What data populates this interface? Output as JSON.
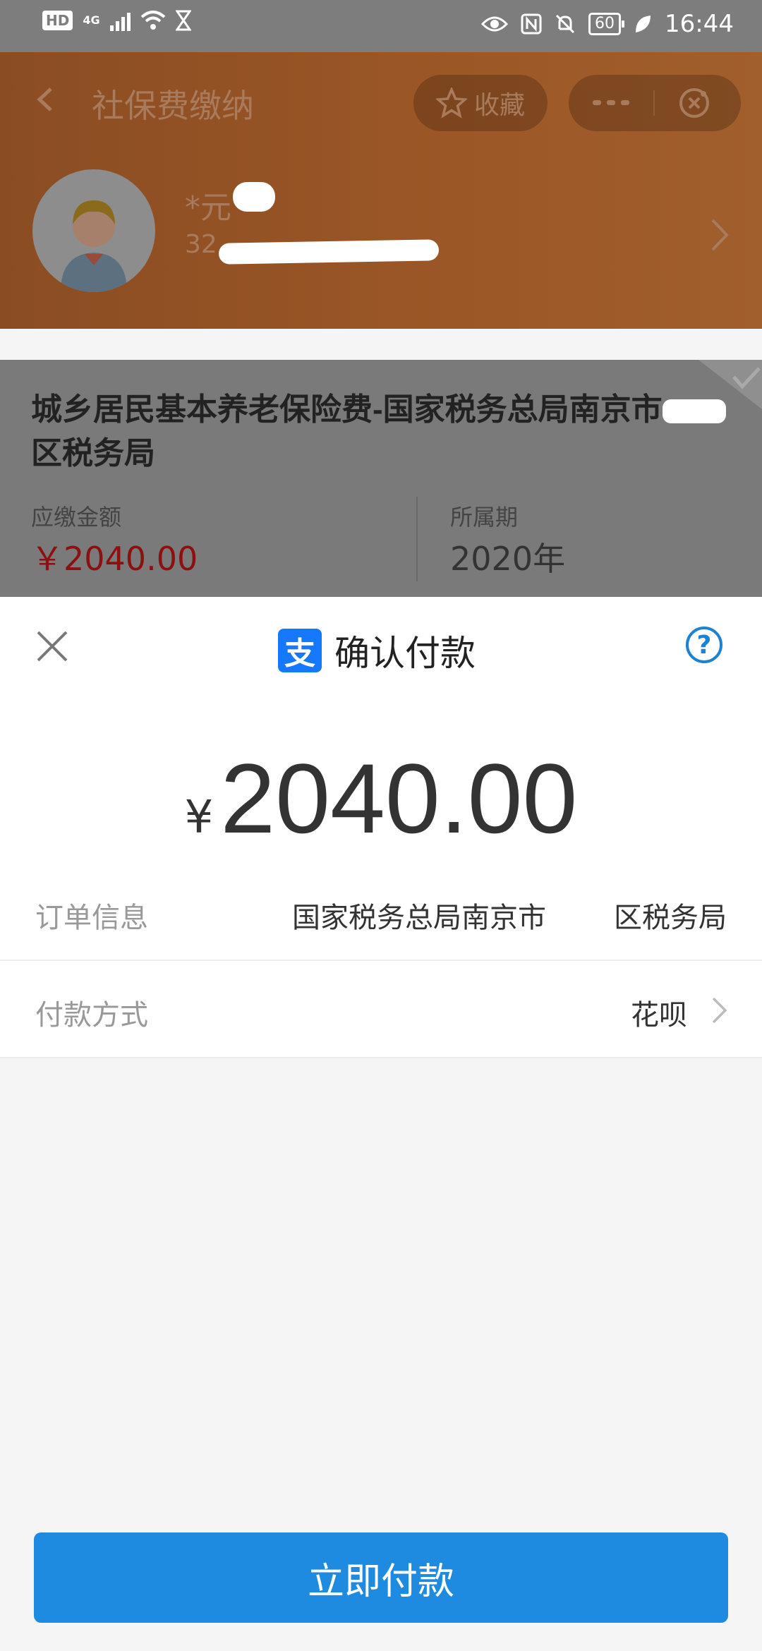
{
  "status_bar": {
    "hd": "HD",
    "network": "4G",
    "battery": "60",
    "time": "16:44"
  },
  "page": {
    "title": "社保费缴纳",
    "favorite_label": "收藏",
    "user": {
      "name": "*元",
      "id": "32"
    }
  },
  "card": {
    "title": "城乡居民基本养老保险费-国家税务总局南京市",
    "title_tail": "区税务局",
    "amount_label": "应缴金额",
    "amount_value": "￥2040.00",
    "period_label": "所属期",
    "period_value": "2020年"
  },
  "sheet": {
    "title": "确认付款",
    "alipay_glyph": "支",
    "help": "?",
    "currency": "¥",
    "amount": "2040.00",
    "order_label": "订单信息",
    "order_value_part1": "国家税务总局南京市",
    "order_value_part2": "区税务局",
    "method_label": "付款方式",
    "method_value": "花呗",
    "pay_button": "立即付款"
  },
  "colors": {
    "header_brown": "#9c5727",
    "accent_blue": "#1e8ae0",
    "amount_red": "#8b1010",
    "alipay_blue": "#1677ff"
  },
  "icons": [
    "back-icon",
    "star-icon",
    "more-icon",
    "mini-close-icon",
    "chevron-right-icon",
    "check-icon",
    "close-icon",
    "alipay-icon",
    "help-icon",
    "wifi-icon",
    "hourglass-icon",
    "eye-icon",
    "nfc-icon",
    "bell-off-icon",
    "leaf-icon"
  ]
}
